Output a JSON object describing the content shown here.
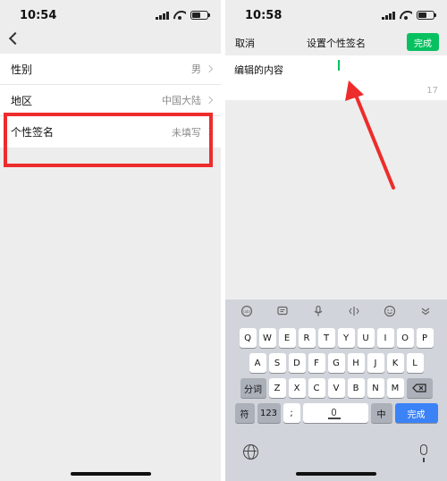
{
  "left": {
    "time": "10:54",
    "rows": [
      {
        "label": "性别",
        "value": "男"
      },
      {
        "label": "地区",
        "value": "中国大陆"
      },
      {
        "label": "个性签名",
        "value": "未填写"
      }
    ]
  },
  "right": {
    "time": "10:58",
    "cancel": "取消",
    "title": "设置个性签名",
    "done": "完成",
    "edit_text": "编辑的内容",
    "char_count": "17",
    "keyboard": {
      "row1": [
        "Q",
        "W",
        "E",
        "R",
        "T",
        "Y",
        "U",
        "I",
        "O",
        "P"
      ],
      "row2": [
        "A",
        "S",
        "D",
        "F",
        "G",
        "H",
        "J",
        "K",
        "L"
      ],
      "row3": [
        "Z",
        "X",
        "C",
        "V",
        "B",
        "N",
        "M"
      ],
      "fenci": "分词",
      "fu": "符",
      "num": "123",
      "punct": ";",
      "cn": "中",
      "enter": "完成"
    }
  },
  "colors": {
    "accent_green": "#07c160",
    "highlight_red": "#ee2c2c",
    "enter_blue": "#3b82f6"
  }
}
